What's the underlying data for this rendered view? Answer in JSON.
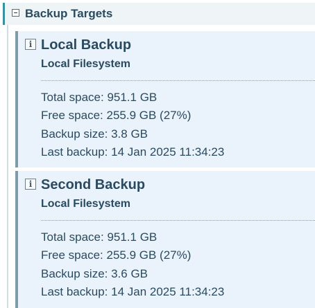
{
  "section": {
    "title": "Backup Targets"
  },
  "targets": [
    {
      "name": "Local Backup",
      "type": "Local Filesystem",
      "total_space": "Total space: 951.1 GB",
      "free_space": "Free space: 255.9 GB (27%)",
      "backup_size": "Backup size: 3.8 GB",
      "last_backup": "Last backup: 14 Jan 2025 11:34:23"
    },
    {
      "name": "Second Backup",
      "type": "Local Filesystem",
      "total_space": "Total space: 951.1 GB",
      "free_space": "Free space: 255.9 GB (27%)",
      "backup_size": "Backup size: 3.6 GB",
      "last_backup": "Last backup: 14 Jan 2025 11:34:23"
    }
  ],
  "icons": {
    "collapse": "collapse-icon",
    "info": "info-icon",
    "info_glyph": "i"
  },
  "colors": {
    "header_bg": "#eff4f7",
    "header_accent": "#3a8fa0",
    "card_bg": "#eaf3fb",
    "card_border": "#7f9aa8",
    "text": "#2a4a5f"
  }
}
